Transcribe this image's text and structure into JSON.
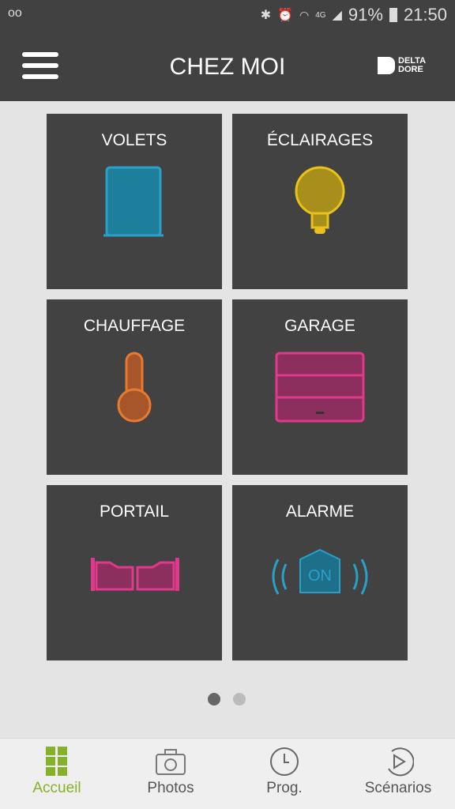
{
  "status": {
    "battery": "91%",
    "time": "21:50",
    "network": "4G"
  },
  "header": {
    "title": "CHEZ MOI",
    "logo": "DELTA DORE"
  },
  "tiles": [
    {
      "label": "VOLETS",
      "icon": "shutter-icon",
      "color": "#2aa0c8"
    },
    {
      "label": "ÉCLAIRAGES",
      "icon": "bulb-icon",
      "color": "#e8c21a"
    },
    {
      "label": "CHAUFFAGE",
      "icon": "thermometer-icon",
      "color": "#e87a30"
    },
    {
      "label": "GARAGE",
      "icon": "garage-door-icon",
      "color": "#e0388a"
    },
    {
      "label": "PORTAIL",
      "icon": "gate-icon",
      "color": "#e0388a"
    },
    {
      "label": "ALARME",
      "icon": "alarm-icon",
      "color": "#2aa0c8",
      "badge": "ON"
    }
  ],
  "pager": {
    "pages": 2,
    "current": 1
  },
  "nav": [
    {
      "label": "Accueil",
      "active": true
    },
    {
      "label": "Photos"
    },
    {
      "label": "Prog."
    },
    {
      "label": "Scénarios"
    }
  ],
  "colors": {
    "accent": "#85b22a",
    "header": "#414141",
    "tile": "#424242"
  }
}
